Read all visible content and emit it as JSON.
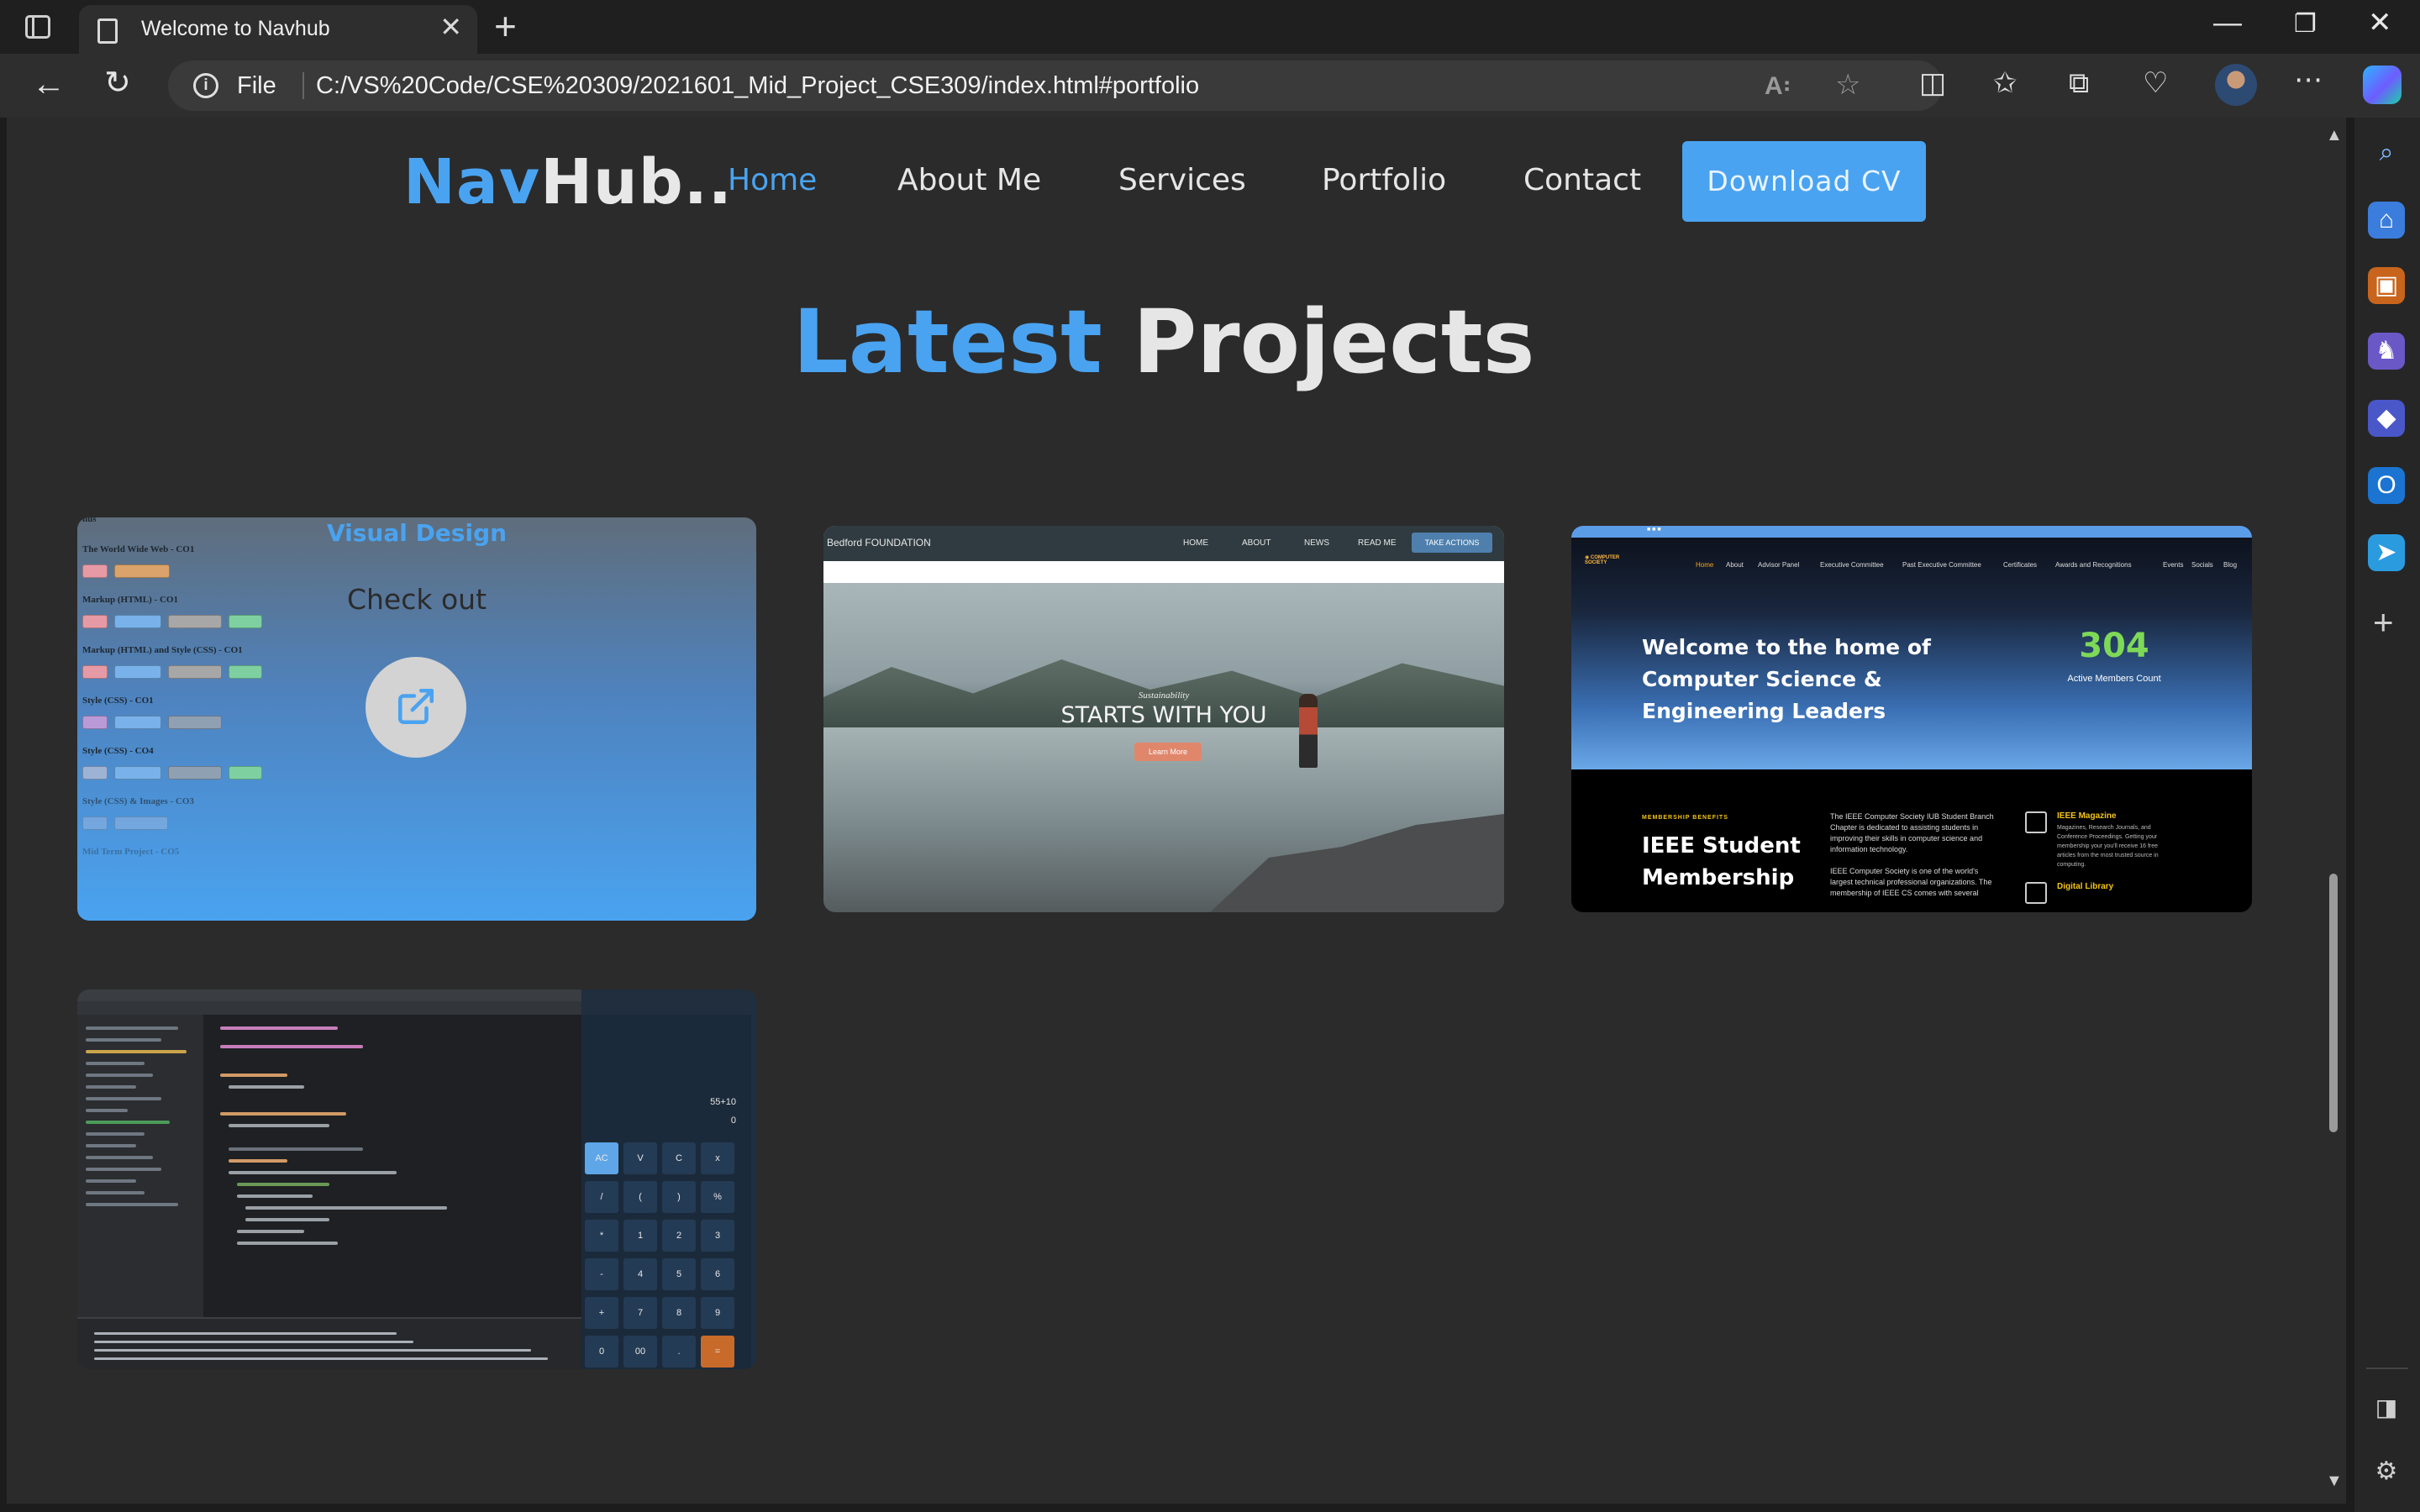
{
  "browser": {
    "tab_title": "Welcome to Navhub",
    "address_label": "File",
    "url": "C:/VS%20Code/CSE%20309/2021601_Mid_Project_CSE309/index.html#portfolio"
  },
  "site": {
    "logo_part1": "Nav",
    "logo_part2": "Hub..",
    "nav": [
      "Home",
      "About Me",
      "Services",
      "Portfolio",
      "Contact"
    ],
    "cv_button": "Download CV",
    "section_title_part1": "Latest",
    "section_title_part2": "Projects",
    "colors": {
      "accent": "#4aa3f0",
      "background": "#2b2b2b",
      "text": "#e6e6e6"
    }
  },
  "portfolio": {
    "card1": {
      "overlay_title": "Visual Design",
      "overlay_subtitle": "Check out",
      "icon": "external-link-icon",
      "doc_lines": [
        "The World Wide Web - CO1",
        "Markup (HTML) - CO1",
        "Markup (HTML) and Style (CSS) - CO1",
        "Style (CSS) - CO1",
        "Style (CSS) - CO4",
        "Style (CSS) & Images - CO3",
        "Mid Term Project - CO5"
      ]
    },
    "card2": {
      "brand": "Bedford FOUNDATION",
      "links": [
        "HOME",
        "ABOUT",
        "NEWS",
        "READ ME"
      ],
      "cta": "TAKE ACTIONS",
      "hero_small": "Sustainability",
      "hero_big": "STARTS WITH YOU",
      "hero_button": "Learn More"
    },
    "card3": {
      "links": [
        "Home",
        "About",
        "Advisor Panel",
        "Executive Committee",
        "Past Executive Committee",
        "Certificates",
        "Awards and Recognitions",
        "Events",
        "Socials",
        "Blog"
      ],
      "hero": "Welcome to the home of Computer Science & Engineering Leaders",
      "members_count": "304",
      "members_label": "Active Members Count",
      "eyebrow": "MEMBERSHIP BENEFITS",
      "membership_title": "IEEE Student Membership",
      "para1": "The IEEE Computer Society IUB Student Branch Chapter is dedicated to assisting students in improving their skills in computer science and information technology.",
      "para2": "IEEE Computer Society is one of the world's largest technical professional organizations. The membership of IEEE CS comes with several",
      "side1_title": "IEEE Magazine",
      "side1_text": "Magazines, Research Journals, and Conference Proceedings. Getting your membership your you'll receive 16 free articles from the most trusted source in computing.",
      "side2_title": "Digital Library"
    },
    "card4": {
      "calc_display": "55+10",
      "calc_result": "0",
      "calc_keys": [
        "AC",
        "V",
        "C",
        "x",
        "/",
        "(",
        ")",
        "%",
        "*",
        "1",
        "2",
        "3",
        "-",
        "4",
        "5",
        "6",
        "+",
        "7",
        "8",
        "9",
        "0",
        "00",
        ".",
        "="
      ]
    }
  }
}
